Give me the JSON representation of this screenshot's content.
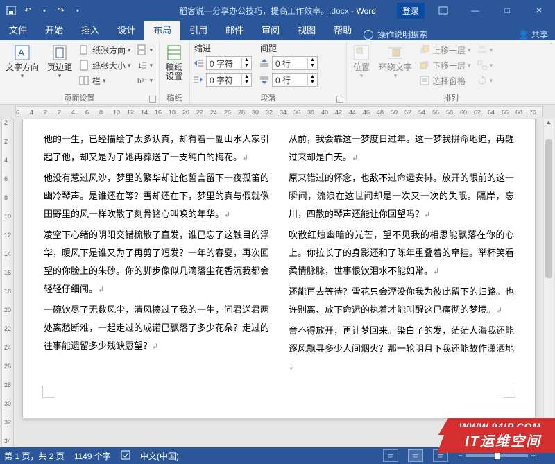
{
  "titlebar": {
    "doc_title": "稻客说—分享办公技巧，提高工作效率。.docx - ",
    "app": "Word",
    "login": "登录"
  },
  "tabs": {
    "file": "文件",
    "home": "开始",
    "insert": "插入",
    "design": "设计",
    "layout": "布局",
    "references": "引用",
    "mailings": "邮件",
    "review": "审阅",
    "view": "视图",
    "help": "帮助",
    "tellme": "操作说明搜索",
    "share": "共享"
  },
  "ribbon": {
    "page_setup": {
      "label": "页面设置",
      "text_direction": "文字方向",
      "margins": "页边距",
      "orientation": "纸张方向",
      "size": "纸张大小",
      "columns": "栏"
    },
    "gaozhi": {
      "label": "稿纸",
      "btn": "稿纸\n设置"
    },
    "paragraph": {
      "label": "段落",
      "indent": "缩进",
      "spacing": "间距",
      "left_val": "0 字符",
      "right_val": "0 字符",
      "before_val": "0 行",
      "after_val": "0 行"
    },
    "arrange": {
      "label": "排列",
      "position": "位置",
      "wrap": "环绕文字",
      "bring_forward": "上移一层",
      "send_backward": "下移一层",
      "selection_pane": "选择窗格"
    }
  },
  "document": {
    "paragraphs": [
      "他的一生，已经描绘了太多认真，却有着一副山水人家引起了他，却又是为了她再葬送了一支纯白的梅花。",
      "他没有惹过风沙，梦里的繁华却让他誓言留下一夜孤笛的幽冷琴声。是谁还在等？雪却还在下，梦里的真与假就像田野里的风一样吹散了刻骨铭心叫唤的年华。",
      "凌空下心绪的阴阳交错梳散了直发，谁已忘了这触目的浮华，暖风下是谁又为了再剪了短发？一年的春夏，再次回望的你脸上的朱砂。你的脚步像似几滴落尘花香沉我都会轻轻仔细闻。",
      "一碗饮尽了无数风尘，清风揍过了我的一生，问君送君两处离愁断难，一起走过的成诺已飘落了多少花朵？走过的往事能遗留多少残缺愿望？",
      "从前，我会靠这一梦度日过年。这一梦我拼命地追，再醒过来却是白天。",
      "原来错过的怀念，也敌不过命运安排。放开的眼前的这一瞬间，流浪在这世间却是一次又一次的失眠。隔岸，忘川，四散的琴声还能让你回望吗？",
      "吹散红烛幽暗的光芒，望不见我的相思能飘落在你的心上。你拉长了的身影还和了陈年重叠着的牵挂。举杯笑看柔情脉脉，世事恨饮泪水不能如常。",
      "还能再去等待？雪花只会湮没你我为彼此留下的归路。也许别离、放下命运的执着才能叫醒这已痛彻的梦境。",
      "舍不得放开，再让梦回来。染白了的发，茫茫人海我还能逐风飘寻多少人间烟火？那一轮明月下我还能故作潇洒地"
    ]
  },
  "status": {
    "page": "第 1 页，共 2 页",
    "words": "1149 个字",
    "lang": "中文(中国)",
    "zoom": "100%"
  },
  "ruler_h": [
    "6",
    "4",
    "2",
    "2",
    "4",
    "6",
    "8",
    "10",
    "12",
    "14",
    "16",
    "18",
    "20",
    "22",
    "24",
    "26",
    "28",
    "30",
    "32",
    "34",
    "36",
    "38",
    "40",
    "42",
    "44",
    "46",
    "48",
    "50",
    "52",
    "54",
    "56",
    "58",
    "60",
    "62",
    "64",
    "66",
    "68",
    "70"
  ],
  "ruler_v": [
    "2",
    "2",
    "4",
    "6",
    "8",
    "10",
    "12",
    "14",
    "16",
    "18",
    "20",
    "22",
    "24",
    "26",
    "28",
    "30",
    "32",
    "34"
  ],
  "watermark": {
    "a": "WWW.94IP.COM",
    "b": "IT运维空间"
  }
}
